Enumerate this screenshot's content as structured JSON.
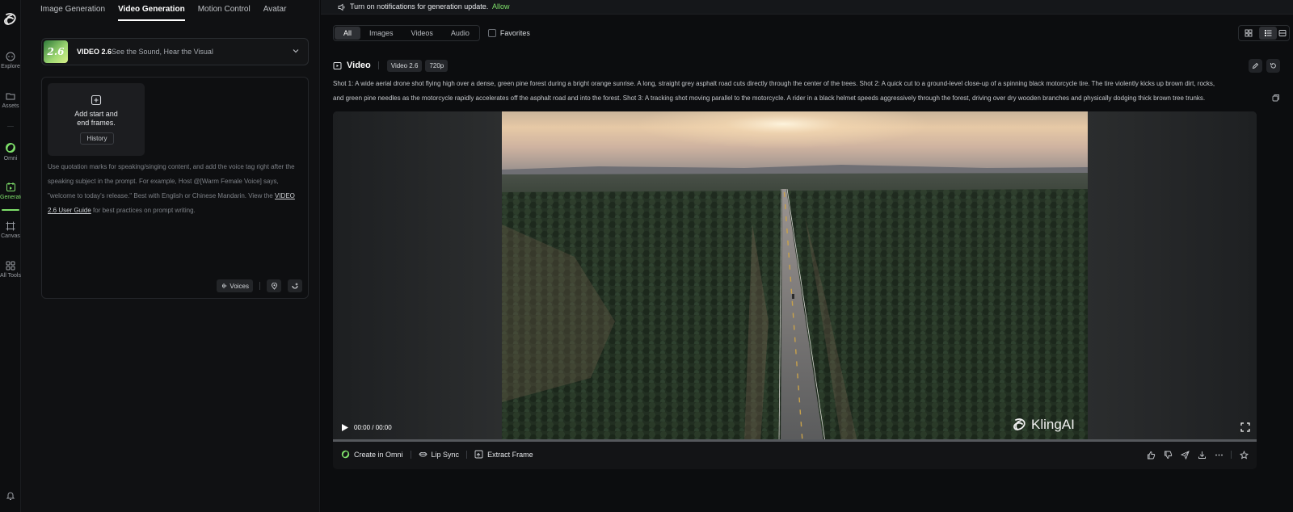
{
  "rail": {
    "items": [
      {
        "label": "Explore",
        "icon": "explore-icon"
      },
      {
        "label": "Assets",
        "icon": "folder-icon"
      },
      {
        "label": "Omni",
        "icon": "omni-icon"
      },
      {
        "label": "Generate",
        "icon": "generate-icon"
      },
      {
        "label": "Canvas",
        "icon": "canvas-icon"
      },
      {
        "label": "All Tools",
        "icon": "grid-icon"
      }
    ],
    "active": "Generate",
    "accent": "#7ee06a"
  },
  "top_tabs": [
    "Image Generation",
    "Video Generation",
    "Motion Control",
    "Avatar"
  ],
  "top_tab_active": "Video Generation",
  "model": {
    "badge": "2.6",
    "name": "VIDEO 2.6",
    "tagline": "See the Sound, Hear the Visual"
  },
  "frames": {
    "line1": "Add start and",
    "line2": "end frames.",
    "history_label": "History"
  },
  "hint": {
    "text": "Use quotation marks for speaking/singing content, and add the voice tag right after the speaking subject in the prompt. For example, Host @[Warm Female Voice] says, \"welcome to today's release.\" Best with English or Chinese Mandarin. View the ",
    "link": "VIDEO 2.6 User Guide",
    "tail": " for best practices on prompt writing."
  },
  "tools": {
    "voices_label": "Voices"
  },
  "notification": {
    "text": "Turn on notifications for generation update.",
    "action": "Allow"
  },
  "filters": {
    "items": [
      "All",
      "Images",
      "Videos",
      "Audio"
    ],
    "active": "All",
    "favorites_label": "Favorites"
  },
  "video": {
    "title": "Video",
    "model_badge": "Video 2.6",
    "resolution_badge": "720p",
    "prompt_line1": "Shot 1: A wide aerial drone shot flying high over a dense, green pine forest during a bright orange sunrise. A long, straight grey asphalt road cuts directly through the center of the trees. Shot 2: A quick cut to a ground-level close-up of a spinning black motorcycle tire. The tire violently kicks up brown dirt, rocks,",
    "prompt_line2": "and green pine needles as the motorcycle rapidly accelerates off the asphalt road and into the forest. Shot 3: A tracking shot moving parallel to the motorcycle. A rider in a black helmet speeds aggressively through the forest, driving over dry wooden branches and physically dodging thick brown tree trunks.",
    "time": "00:00 / 00:00",
    "progress": 0,
    "watermark": "KlingAI"
  },
  "actions": {
    "create_in_omni": "Create in Omni",
    "lip_sync": "Lip Sync",
    "extract_frame": "Extract Frame"
  }
}
